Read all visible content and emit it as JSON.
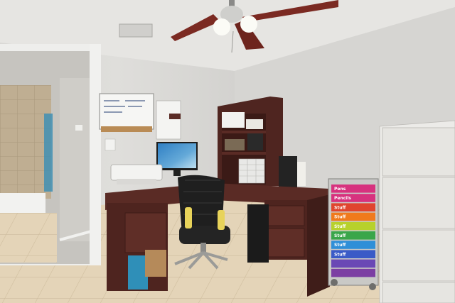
{
  "scene": {
    "kind": "photo-of-home-office",
    "objects": [
      "ceiling-fan",
      "whiteboard",
      "wall-calendar",
      "printer",
      "monitor",
      "office-chair",
      "l-shaped-desk",
      "bookshelf-hutch",
      "pc-tower",
      "rolling-drawer-cart",
      "filing-cabinet",
      "bathroom-doorway",
      "tile-floor"
    ]
  },
  "cart": {
    "labels": [
      "Pens",
      "Pencils",
      "Stuff",
      "Stuff",
      "Stuff",
      "Stuff",
      "Stuff",
      "Stuff"
    ],
    "drawer_colors": [
      "#d7327e",
      "#d7327e",
      "#e0452f",
      "#f07a1c",
      "#b7d12c",
      "#3aa64a",
      "#2f8fd8",
      "#3a5bc7",
      "#6a48b5",
      "#7c3fa3"
    ]
  },
  "colors": {
    "wall": "#dddcd9",
    "ceiling": "#e6e5e2",
    "floor_tile": "#e4d4b8",
    "desk_wood": "#5a2b25",
    "cabinet": "#ecebe8",
    "fan_blade": "#7b2a22"
  }
}
